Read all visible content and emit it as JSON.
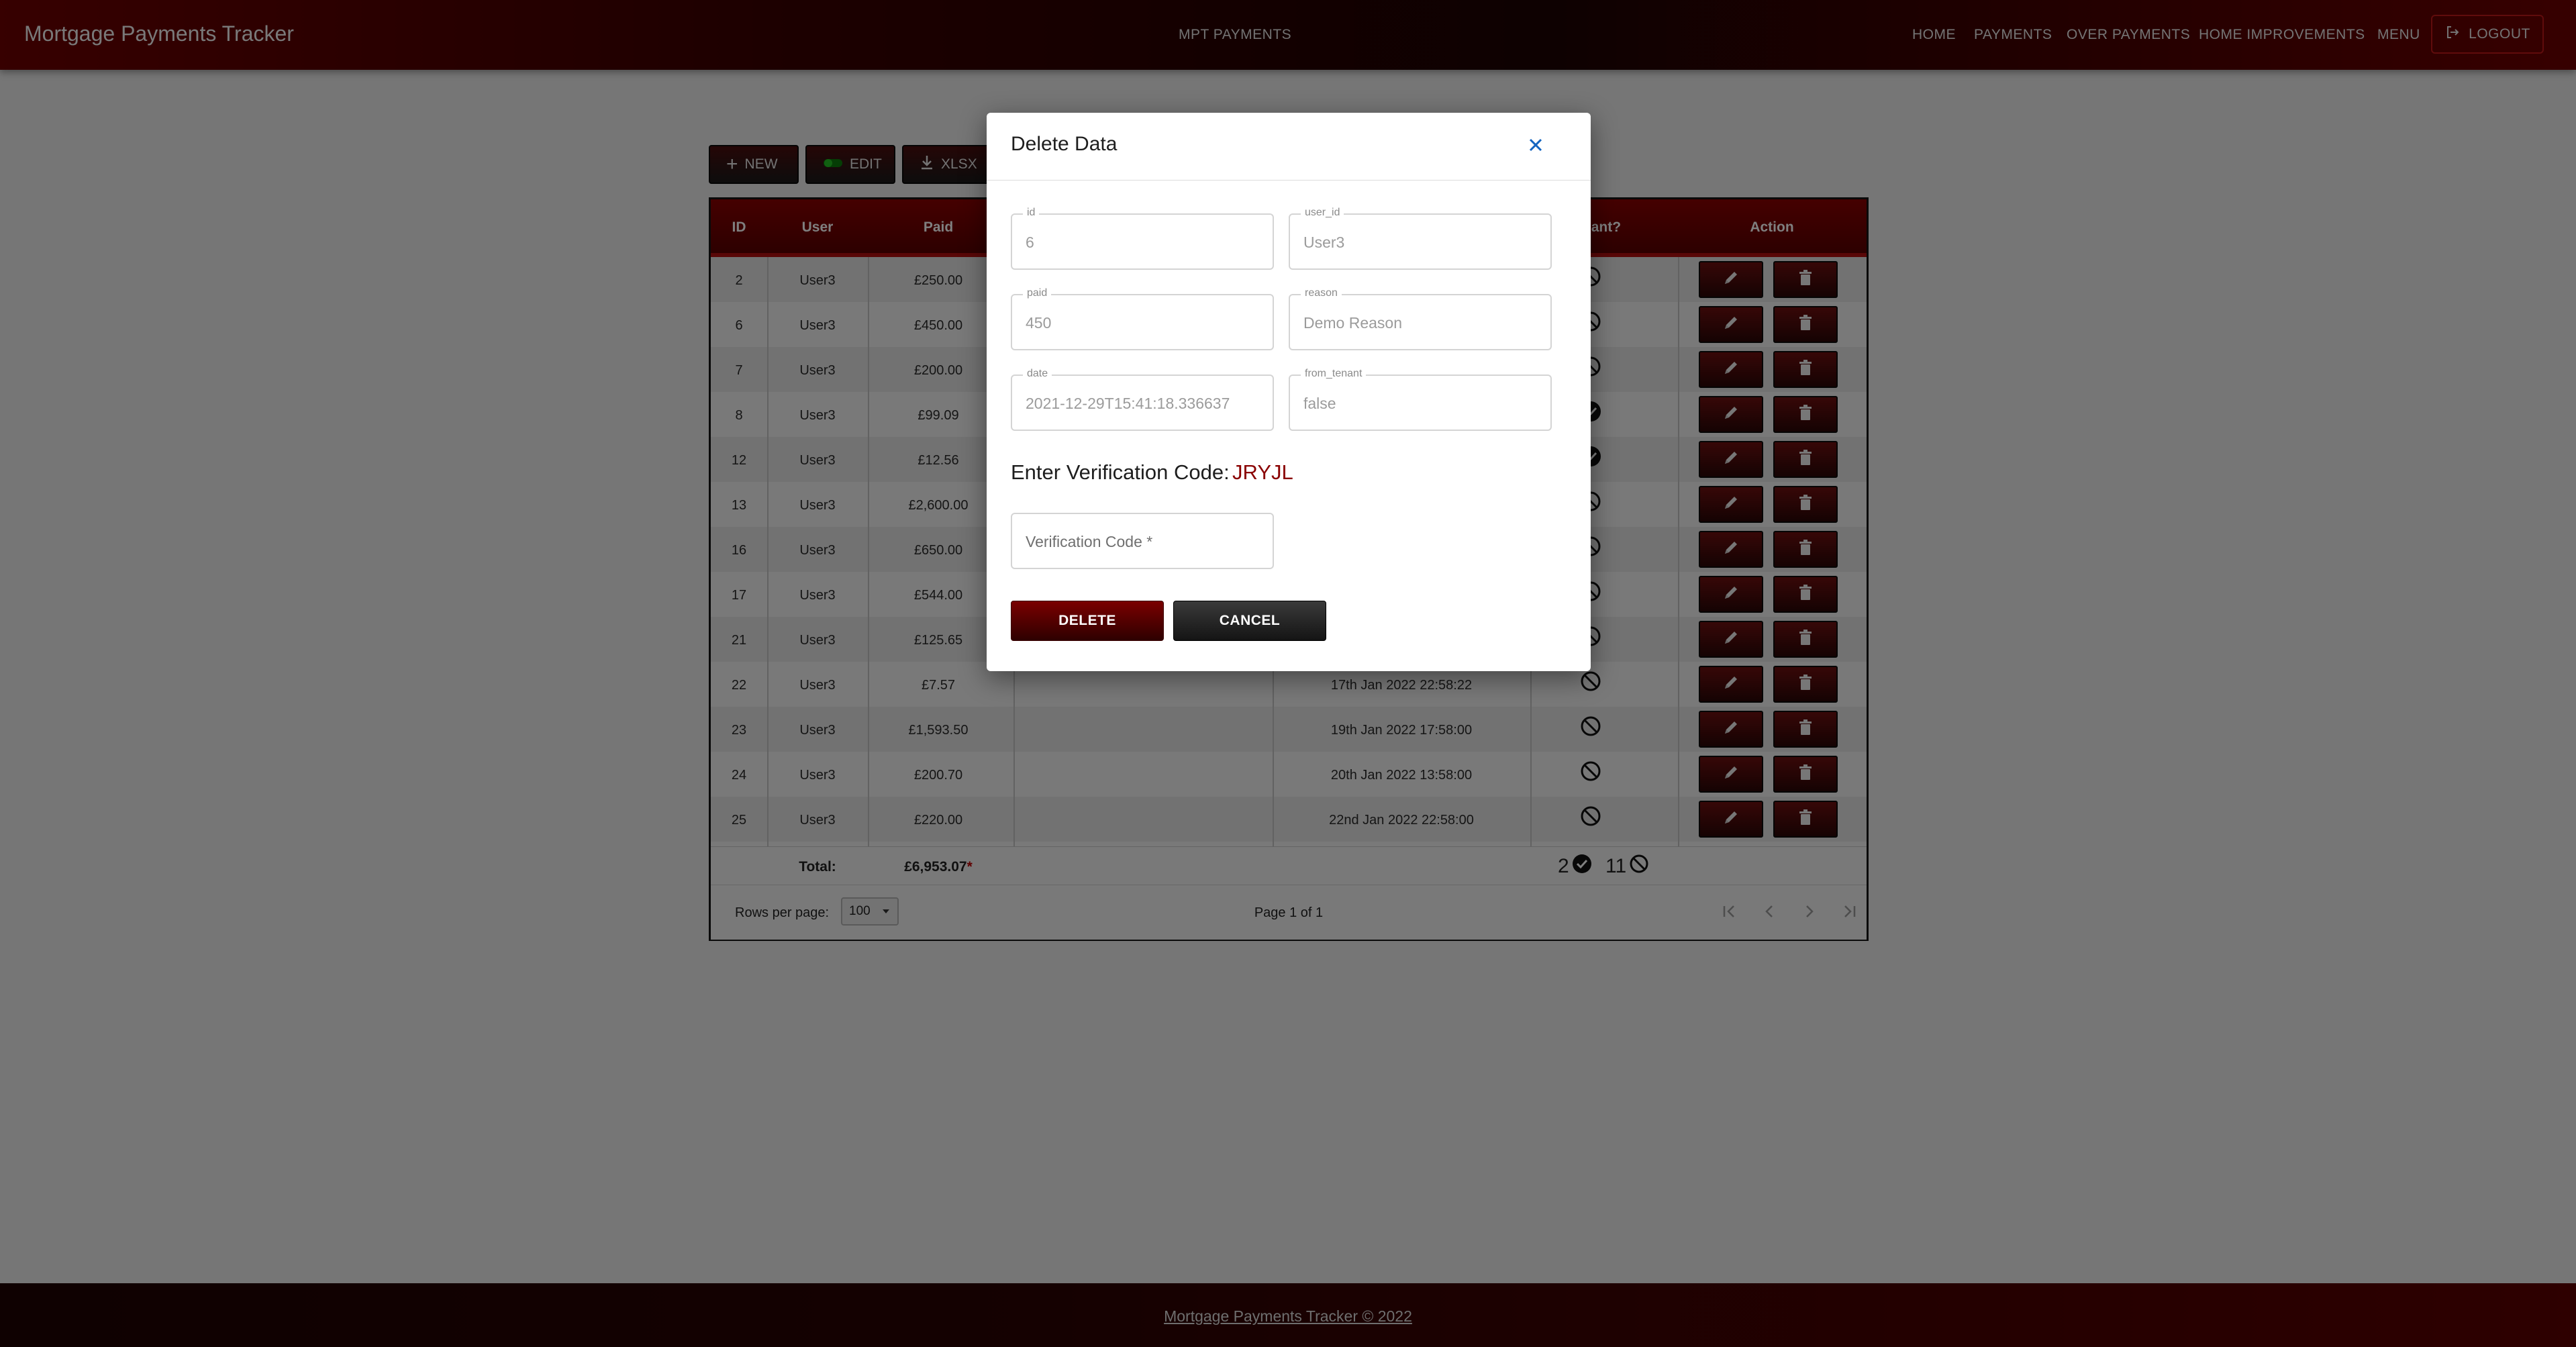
{
  "header": {
    "title": "Mortgage Payments Tracker",
    "center_label": "MPT PAYMENTS",
    "nav": [
      "HOME",
      "PAYMENTS",
      "OVER PAYMENTS",
      "HOME IMPROVEMENTS",
      "MENU"
    ],
    "logout_label": "LOGOUT"
  },
  "toolbar": {
    "new_label": "NEW",
    "edit_label": "EDIT",
    "xlsx_label": "XLSX"
  },
  "table": {
    "columns": [
      "ID",
      "User",
      "Paid",
      "Tenant?",
      "Action"
    ],
    "rows": [
      {
        "id": "2",
        "user": "User3",
        "paid": "£250.00",
        "date": "",
        "tenant": false
      },
      {
        "id": "6",
        "user": "User3",
        "paid": "£450.00",
        "date": "",
        "tenant": false
      },
      {
        "id": "7",
        "user": "User3",
        "paid": "£200.00",
        "date": "",
        "tenant": false
      },
      {
        "id": "8",
        "user": "User3",
        "paid": "£99.09",
        "date": "",
        "tenant": true
      },
      {
        "id": "12",
        "user": "User3",
        "paid": "£12.56",
        "date": "",
        "tenant": true
      },
      {
        "id": "13",
        "user": "User3",
        "paid": "£2,600.00",
        "date": "",
        "tenant": false
      },
      {
        "id": "16",
        "user": "User3",
        "paid": "£650.00",
        "date": "",
        "tenant": false
      },
      {
        "id": "17",
        "user": "User3",
        "paid": "£544.00",
        "date": "",
        "tenant": false
      },
      {
        "id": "21",
        "user": "User3",
        "paid": "£125.65",
        "date": "",
        "tenant": false
      },
      {
        "id": "22",
        "user": "User3",
        "paid": "£7.57",
        "date": "17th Jan 2022 22:58:22",
        "tenant": false
      },
      {
        "id": "23",
        "user": "User3",
        "paid": "£1,593.50",
        "date": "19th Jan 2022 17:58:00",
        "tenant": false
      },
      {
        "id": "24",
        "user": "User3",
        "paid": "£200.70",
        "date": "20th Jan 2022 13:58:00",
        "tenant": false
      },
      {
        "id": "25",
        "user": "User3",
        "paid": "£220.00",
        "date": "22nd Jan 2022 22:58:00",
        "tenant": false
      }
    ],
    "total_label": "Total:",
    "total_paid": "£6,953.07",
    "total_asterisk": "*",
    "tenant_yes_count": "2",
    "tenant_no_count": "11",
    "rows_per_page_label": "Rows per page:",
    "rows_per_page": "100",
    "page_info": "Page 1 of 1"
  },
  "modal": {
    "title": "Delete Data",
    "fields": [
      {
        "label": "id",
        "value": "6"
      },
      {
        "label": "user_id",
        "value": "User3"
      },
      {
        "label": "paid",
        "value": "450"
      },
      {
        "label": "reason",
        "value": "Demo Reason"
      },
      {
        "label": "date",
        "value": "2021-12-29T15:41:18.336637"
      },
      {
        "label": "from_tenant",
        "value": "false"
      }
    ],
    "verify_text": "Enter Verification Code:",
    "verify_code": "JRYJL",
    "verification_placeholder": "Verification Code *",
    "delete_label": "DELETE",
    "cancel_label": "CANCEL"
  },
  "footer": {
    "text": "Mortgage Payments Tracker © 2022"
  },
  "colors": {
    "brand_red": "#8a0000",
    "accent_blue": "#1565c0"
  }
}
